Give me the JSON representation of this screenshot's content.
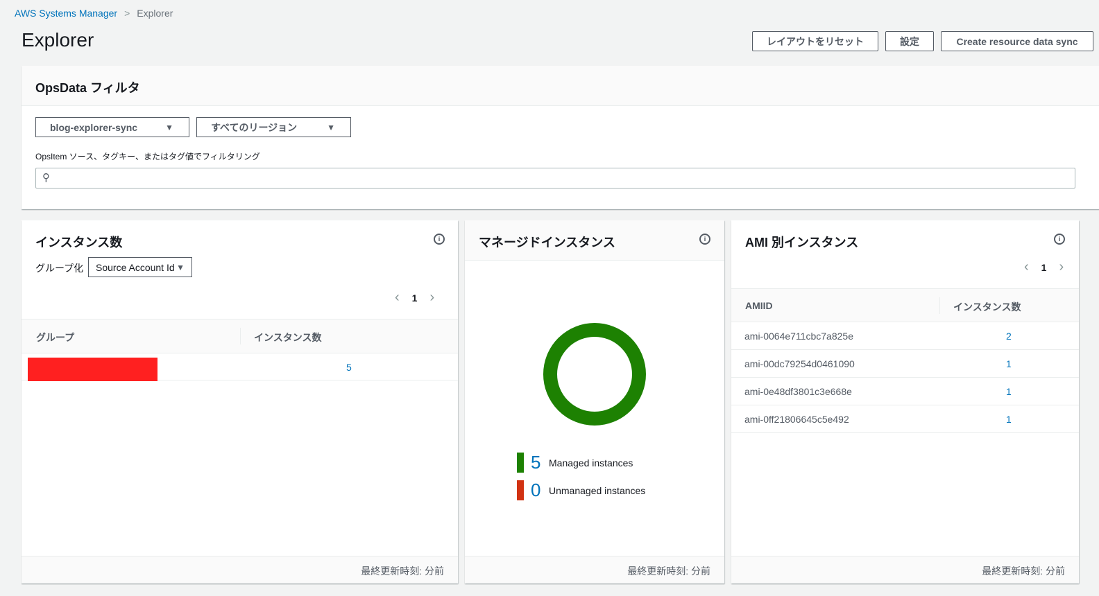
{
  "breadcrumb": {
    "parent": "AWS Systems Manager",
    "current": "Explorer"
  },
  "page_title": "Explorer",
  "actions": {
    "reset_layout": "レイアウトをリセット",
    "settings": "設定",
    "create_sync": "Create resource data sync"
  },
  "filter": {
    "title": "OpsData フィルタ",
    "sync_select": "blog-explorer-sync",
    "region_select": "すべてのリージョン",
    "search_label": "OpsItem ソース、タグキー、またはタグ値でフィルタリング",
    "search_value": ""
  },
  "widgets": {
    "instance_count": {
      "title": "インスタンス数",
      "group_label": "グループ化",
      "group_select": "Source Account Id",
      "page": "1",
      "columns": [
        "グループ",
        "インスタンス数"
      ],
      "rows": [
        {
          "group": "",
          "count": "5"
        }
      ],
      "footer": "最終更新時刻: 分前"
    },
    "managed": {
      "title": "マネージドインスタンス",
      "managed_count": "5",
      "managed_label": "Managed instances",
      "unmanaged_count": "0",
      "unmanaged_label": "Unmanaged instances",
      "colors": {
        "managed": "#1d8102",
        "unmanaged": "#d13212"
      },
      "footer": "最終更新時刻: 分前"
    },
    "ami": {
      "title": "AMI 別インスタンス",
      "page": "1",
      "columns": [
        "AMIID",
        "インスタンス数"
      ],
      "rows": [
        {
          "id": "ami-0064e711cbc7a825e",
          "count": "2"
        },
        {
          "id": "ami-00dc79254d0461090",
          "count": "1"
        },
        {
          "id": "ami-0e48df3801c3e668e",
          "count": "1"
        },
        {
          "id": "ami-0ff21806645c5e492",
          "count": "1"
        }
      ],
      "footer": "最終更新時刻: 分前"
    }
  }
}
